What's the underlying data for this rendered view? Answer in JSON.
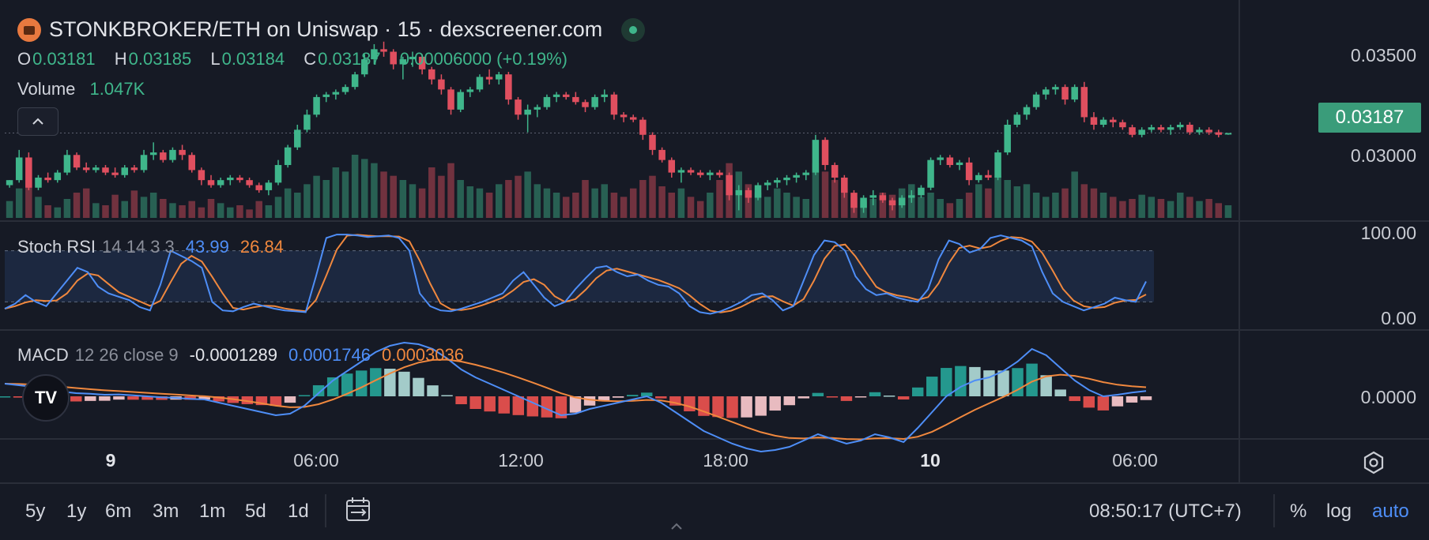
{
  "header": {
    "title": "STONKBROKER/ETH on Uniswap · 15 · dexscreener.com",
    "ohlc": [
      {
        "key": "O",
        "value": "0.03181"
      },
      {
        "key": "H",
        "value": "0.03185"
      },
      {
        "key": "L",
        "value": "0.03184"
      },
      {
        "key": "C",
        "value": "0.03187"
      }
    ],
    "change": "0.00006000 (+0.19%)",
    "volume_label": "Volume",
    "volume_value": "1.047K",
    "collapse_icon": "chevron-up-icon"
  },
  "indicators": {
    "stoch": {
      "name": "Stoch RSI",
      "params": "14 14 3 3",
      "k": "43.99",
      "d": "26.84"
    },
    "macd": {
      "name": "MACD",
      "params": "12 26 close 9",
      "hist": "-0.0001289",
      "macd": "0.0001746",
      "signal": "0.0003036"
    }
  },
  "price_axis": {
    "main": [
      "0.03500",
      "0.03000"
    ],
    "last_price": "0.03187",
    "stoch": [
      "100.00",
      "0.00"
    ],
    "macd": [
      "0.0000"
    ]
  },
  "time_axis": [
    {
      "label": "9",
      "bold": true
    },
    {
      "label": "06:00",
      "bold": false
    },
    {
      "label": "12:00",
      "bold": false
    },
    {
      "label": "18:00",
      "bold": false
    },
    {
      "label": "10",
      "bold": true
    },
    {
      "label": "06:00",
      "bold": false
    }
  ],
  "toolbar": {
    "ranges": [
      "5y",
      "1y",
      "6m",
      "3m",
      "1m",
      "5d",
      "1d"
    ],
    "clock": "08:50:17 (UTC+7)",
    "percent": "%",
    "log": "log",
    "auto": "auto",
    "calendar_icon": "calendar-range-icon",
    "settings_icon": "settings-icon"
  },
  "logo_text": "TV",
  "colors": {
    "up": "#3fb68b",
    "down": "#e04f5f",
    "stoch_k": "#4e8ef7",
    "stoch_d": "#f0883e",
    "background": "#161a25"
  },
  "chart_data": {
    "type": "candlestick",
    "ylim": [
      0.0285,
      0.0359
    ],
    "yticks": [
      0.035,
      0.03
    ],
    "last_price": 0.03187,
    "candles": [
      [
        0.0298,
        0.03,
        0.0297,
        0.03
      ],
      [
        0.03,
        0.0312,
        0.0299,
        0.0309
      ],
      [
        0.0309,
        0.0311,
        0.0296,
        0.0297
      ],
      [
        0.0297,
        0.0302,
        0.0296,
        0.0301
      ],
      [
        0.0301,
        0.0303,
        0.0299,
        0.03
      ],
      [
        0.03,
        0.0304,
        0.0299,
        0.0303
      ],
      [
        0.0303,
        0.0312,
        0.0302,
        0.031
      ],
      [
        0.031,
        0.0311,
        0.0304,
        0.0305
      ],
      [
        0.0305,
        0.0307,
        0.0303,
        0.0304
      ],
      [
        0.0304,
        0.0306,
        0.0303,
        0.0305
      ],
      [
        0.0305,
        0.0306,
        0.0302,
        0.0303
      ],
      [
        0.0303,
        0.0305,
        0.0301,
        0.0302
      ],
      [
        0.0302,
        0.0306,
        0.0301,
        0.0305
      ],
      [
        0.0305,
        0.0306,
        0.0303,
        0.0304
      ],
      [
        0.0304,
        0.0312,
        0.0303,
        0.031
      ],
      [
        0.031,
        0.0315,
        0.0308,
        0.0311
      ],
      [
        0.0311,
        0.0312,
        0.0307,
        0.0308
      ],
      [
        0.0308,
        0.0313,
        0.0307,
        0.0312
      ],
      [
        0.0312,
        0.0314,
        0.0308,
        0.031
      ],
      [
        0.031,
        0.0311,
        0.0303,
        0.0304
      ],
      [
        0.0304,
        0.0305,
        0.0298,
        0.03
      ],
      [
        0.03,
        0.0302,
        0.0297,
        0.0298
      ],
      [
        0.0298,
        0.0301,
        0.0297,
        0.03
      ],
      [
        0.03,
        0.0302,
        0.0298,
        0.0301
      ],
      [
        0.0301,
        0.0302,
        0.0299,
        0.03
      ],
      [
        0.03,
        0.0301,
        0.0297,
        0.0298
      ],
      [
        0.0298,
        0.0299,
        0.0295,
        0.0296
      ],
      [
        0.0296,
        0.03,
        0.0294,
        0.0299
      ],
      [
        0.0299,
        0.0308,
        0.0298,
        0.0306
      ],
      [
        0.0306,
        0.0314,
        0.0305,
        0.0313
      ],
      [
        0.0313,
        0.0322,
        0.0312,
        0.032
      ],
      [
        0.032,
        0.0328,
        0.0319,
        0.0326
      ],
      [
        0.0326,
        0.0334,
        0.0325,
        0.0333
      ],
      [
        0.0333,
        0.0335,
        0.0331,
        0.0334
      ],
      [
        0.0334,
        0.0336,
        0.0332,
        0.0335
      ],
      [
        0.0335,
        0.0338,
        0.0334,
        0.0337
      ],
      [
        0.0337,
        0.0343,
        0.0336,
        0.0342
      ],
      [
        0.0342,
        0.035,
        0.0341,
        0.0348
      ],
      [
        0.0348,
        0.0354,
        0.0346,
        0.0352
      ],
      [
        0.0352,
        0.0355,
        0.0349,
        0.0351
      ],
      [
        0.0351,
        0.0352,
        0.0344,
        0.0346
      ],
      [
        0.0346,
        0.0349,
        0.034,
        0.0348
      ],
      [
        0.0348,
        0.0351,
        0.0345,
        0.0349
      ],
      [
        0.0349,
        0.035,
        0.0342,
        0.0344
      ],
      [
        0.0344,
        0.0345,
        0.0338,
        0.034
      ],
      [
        0.034,
        0.0342,
        0.0334,
        0.0336
      ],
      [
        0.0336,
        0.0337,
        0.0326,
        0.0328
      ],
      [
        0.0328,
        0.0336,
        0.0327,
        0.0335
      ],
      [
        0.0335,
        0.0337,
        0.0333,
        0.0336
      ],
      [
        0.0336,
        0.0342,
        0.0335,
        0.0341
      ],
      [
        0.0341,
        0.0344,
        0.0338,
        0.034
      ],
      [
        0.034,
        0.0343,
        0.0338,
        0.0342
      ],
      [
        0.0342,
        0.0343,
        0.033,
        0.0332
      ],
      [
        0.0332,
        0.0333,
        0.0324,
        0.0326
      ],
      [
        0.0326,
        0.033,
        0.0319,
        0.0328
      ],
      [
        0.0328,
        0.033,
        0.0325,
        0.0329
      ],
      [
        0.0329,
        0.0334,
        0.0328,
        0.0333
      ],
      [
        0.0333,
        0.0335,
        0.0331,
        0.0334
      ],
      [
        0.0334,
        0.0335,
        0.0332,
        0.0333
      ],
      [
        0.0333,
        0.0335,
        0.033,
        0.0331
      ],
      [
        0.0331,
        0.0332,
        0.0327,
        0.0329
      ],
      [
        0.0329,
        0.0334,
        0.0328,
        0.0333
      ],
      [
        0.0333,
        0.0336,
        0.0331,
        0.0334
      ],
      [
        0.0334,
        0.0335,
        0.0324,
        0.0326
      ],
      [
        0.0326,
        0.0327,
        0.0323,
        0.0325
      ],
      [
        0.0325,
        0.0326,
        0.0323,
        0.0324
      ],
      [
        0.0324,
        0.0325,
        0.0316,
        0.0318
      ],
      [
        0.0318,
        0.0319,
        0.031,
        0.0312
      ],
      [
        0.0312,
        0.0313,
        0.0307,
        0.0308
      ],
      [
        0.0308,
        0.0309,
        0.0301,
        0.0303
      ],
      [
        0.0303,
        0.0305,
        0.0299,
        0.0304
      ],
      [
        0.0304,
        0.0305,
        0.0302,
        0.0303
      ],
      [
        0.0303,
        0.0304,
        0.0301,
        0.0302
      ],
      [
        0.0302,
        0.0304,
        0.03,
        0.0303
      ],
      [
        0.0303,
        0.0304,
        0.0301,
        0.0302
      ],
      [
        0.0302,
        0.0303,
        0.0292,
        0.0294
      ],
      [
        0.0294,
        0.0298,
        0.0288,
        0.0296
      ],
      [
        0.0296,
        0.0297,
        0.0291,
        0.0293
      ],
      [
        0.0293,
        0.0299,
        0.0292,
        0.0298
      ],
      [
        0.0298,
        0.03,
        0.0296,
        0.0299
      ],
      [
        0.0299,
        0.0301,
        0.0297,
        0.03
      ],
      [
        0.03,
        0.0302,
        0.0298,
        0.0301
      ],
      [
        0.0301,
        0.0303,
        0.0299,
        0.0302
      ],
      [
        0.0302,
        0.0304,
        0.03,
        0.0303
      ],
      [
        0.0303,
        0.0318,
        0.0302,
        0.0316
      ],
      [
        0.0316,
        0.0317,
        0.0304,
        0.0306
      ],
      [
        0.0306,
        0.0307,
        0.0299,
        0.0301
      ],
      [
        0.0301,
        0.0302,
        0.0293,
        0.0295
      ],
      [
        0.0295,
        0.0296,
        0.0287,
        0.0289
      ],
      [
        0.0289,
        0.0294,
        0.0287,
        0.0293
      ],
      [
        0.0293,
        0.0296,
        0.029,
        0.0294
      ],
      [
        0.0294,
        0.0295,
        0.0291,
        0.0292
      ],
      [
        0.0292,
        0.0293,
        0.0288,
        0.029
      ],
      [
        0.029,
        0.0294,
        0.0289,
        0.0293
      ],
      [
        0.0293,
        0.0296,
        0.0291,
        0.0294
      ],
      [
        0.0294,
        0.0298,
        0.0293,
        0.0297
      ],
      [
        0.0297,
        0.0309,
        0.0296,
        0.0308
      ],
      [
        0.0308,
        0.031,
        0.0306,
        0.0309
      ],
      [
        0.0309,
        0.031,
        0.0305,
        0.0306
      ],
      [
        0.0306,
        0.0308,
        0.0304,
        0.0307
      ],
      [
        0.0307,
        0.0309,
        0.0298,
        0.03
      ],
      [
        0.03,
        0.0303,
        0.0299,
        0.0302
      ],
      [
        0.0302,
        0.0304,
        0.03,
        0.0301
      ],
      [
        0.0301,
        0.0312,
        0.03,
        0.0311
      ],
      [
        0.0311,
        0.0324,
        0.031,
        0.0322
      ],
      [
        0.0322,
        0.0327,
        0.0321,
        0.0326
      ],
      [
        0.0326,
        0.033,
        0.0324,
        0.0329
      ],
      [
        0.0329,
        0.0335,
        0.0328,
        0.0334
      ],
      [
        0.0334,
        0.0337,
        0.0332,
        0.0336
      ],
      [
        0.0336,
        0.0338,
        0.0334,
        0.0337
      ],
      [
        0.0337,
        0.0338,
        0.033,
        0.0332
      ],
      [
        0.0332,
        0.0338,
        0.0331,
        0.0337
      ],
      [
        0.0337,
        0.0339,
        0.0323,
        0.0325
      ],
      [
        0.0325,
        0.0327,
        0.032,
        0.0322
      ],
      [
        0.0322,
        0.0325,
        0.0321,
        0.0324
      ],
      [
        0.0324,
        0.0325,
        0.0321,
        0.0323
      ],
      [
        0.0323,
        0.0324,
        0.032,
        0.0321
      ],
      [
        0.0321,
        0.0322,
        0.0317,
        0.0318
      ],
      [
        0.0318,
        0.0321,
        0.0317,
        0.032
      ],
      [
        0.032,
        0.0322,
        0.0319,
        0.0321
      ],
      [
        0.0321,
        0.0322,
        0.0319,
        0.032
      ],
      [
        0.032,
        0.0322,
        0.0318,
        0.0321
      ],
      [
        0.0321,
        0.0323,
        0.032,
        0.0322
      ],
      [
        0.0322,
        0.0323,
        0.0318,
        0.0319
      ],
      [
        0.0319,
        0.0321,
        0.0318,
        0.032
      ],
      [
        0.032,
        0.0321,
        0.0318,
        0.0319
      ],
      [
        0.0319,
        0.032,
        0.0317,
        0.0318
      ],
      [
        0.03181,
        0.03185,
        0.0318,
        0.03187
      ]
    ],
    "volume": [
      8,
      14,
      18,
      10,
      6,
      5,
      9,
      12,
      14,
      7,
      6,
      11,
      8,
      13,
      10,
      12,
      9,
      7,
      6,
      8,
      5,
      9,
      7,
      5,
      6,
      4,
      8,
      6,
      10,
      14,
      12,
      16,
      20,
      18,
      24,
      22,
      30,
      28,
      26,
      22,
      20,
      18,
      16,
      14,
      24,
      20,
      26,
      18,
      15,
      14,
      12,
      16,
      18,
      20,
      22,
      16,
      14,
      12,
      10,
      12,
      18,
      14,
      16,
      12,
      10,
      14,
      18,
      20,
      15,
      12,
      14,
      10,
      8,
      12,
      18,
      26,
      22,
      16,
      12,
      10,
      14,
      12,
      10,
      9,
      26,
      22,
      18,
      14,
      10,
      8,
      9,
      12,
      11,
      14,
      16,
      10,
      12,
      9,
      7,
      9,
      12,
      16,
      14,
      20,
      18,
      15,
      16,
      12,
      10,
      12,
      14,
      22,
      16,
      14,
      12,
      10,
      8,
      9,
      11,
      10,
      9,
      8,
      12,
      10,
      8,
      9,
      7,
      6
    ],
    "stoch_rsi": {
      "ylim": [
        0,
        100
      ],
      "bands": [
        80,
        20
      ],
      "k": [
        12,
        18,
        28,
        20,
        15,
        30,
        45,
        60,
        55,
        38,
        30,
        26,
        22,
        14,
        10,
        40,
        80,
        74,
        68,
        60,
        20,
        10,
        9,
        14,
        18,
        15,
        12,
        10,
        9,
        8,
        50,
        95,
        99,
        99,
        98,
        96,
        97,
        98,
        95,
        80,
        30,
        15,
        10,
        9,
        12,
        16,
        20,
        25,
        30,
        45,
        55,
        40,
        25,
        15,
        20,
        35,
        48,
        60,
        62,
        55,
        50,
        52,
        45,
        40,
        38,
        30,
        15,
        8,
        6,
        9,
        14,
        20,
        28,
        30,
        22,
        10,
        15,
        45,
        75,
        92,
        90,
        80,
        50,
        35,
        28,
        30,
        25,
        22,
        20,
        35,
        70,
        92,
        88,
        78,
        82,
        95,
        98,
        95,
        92,
        85,
        55,
        30,
        20,
        15,
        10,
        14,
        18,
        25,
        22,
        20,
        44
      ]
    },
    "macd": {
      "macd": [
        0.0004,
        0.00035,
        0.0003,
        0.00022,
        0.00015,
        0.0001,
        8e-05,
        5e-05,
        6e-05,
        3e-05,
        0.0,
        -3e-05,
        -5e-05,
        -8e-05,
        -0.0001,
        -0.0002,
        -0.0003,
        -0.0004,
        -0.0005,
        -0.0006,
        -0.00055,
        -0.0003,
        0.0001,
        0.0005,
        0.0008,
        0.0011,
        0.0014,
        0.0016,
        0.0017,
        0.00165,
        0.0015,
        0.0012,
        0.00085,
        0.0006,
        0.0004,
        0.0002,
        0.0,
        -0.0002,
        -0.0004,
        -0.0006,
        -0.00055,
        -0.0004,
        -0.0003,
        -0.0002,
        -0.0001,
        0.0,
        -0.0002,
        -0.0005,
        -0.0008,
        -0.0011,
        -0.0013,
        -0.0015,
        -0.00165,
        -0.00175,
        -0.0017,
        -0.0016,
        -0.0014,
        -0.0012,
        -0.00135,
        -0.0015,
        -0.0014,
        -0.0012,
        -0.0013,
        -0.00145,
        -0.001,
        -0.0005,
        0.0,
        0.0003,
        0.0005,
        0.0006,
        0.0008,
        0.0011,
        0.0015,
        0.0013,
        0.0009,
        0.0005,
        0.0002,
        0.0,
        5e-05,
        0.00012,
        0.00017
      ]
    }
  }
}
